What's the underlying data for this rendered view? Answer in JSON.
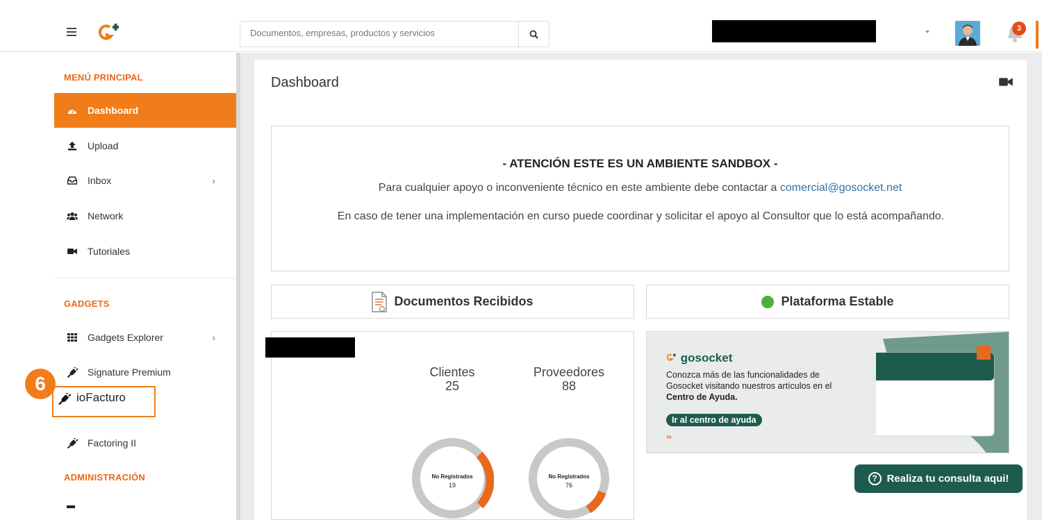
{
  "header": {
    "search_placeholder": "Documentos, empresas, productos y servicios",
    "notification_count": "3"
  },
  "sidebar": {
    "main_title": "MENÚ PRINCIPAL",
    "items": [
      {
        "label": "Dashboard",
        "icon": "tachometer-icon"
      },
      {
        "label": "Upload",
        "icon": "upload-icon"
      },
      {
        "label": "Inbox",
        "icon": "inbox-icon"
      },
      {
        "label": "Network",
        "icon": "users-icon"
      },
      {
        "label": "Tutoriales",
        "icon": "video-camera-icon"
      }
    ],
    "gadgets_title": "GADGETS",
    "gadgets": [
      {
        "label": "Gadgets Explorer",
        "icon": "grid-icon"
      },
      {
        "label": "Signature Premium",
        "icon": "plug-icon"
      },
      {
        "label": "ioFacturo",
        "icon": "plug-icon"
      },
      {
        "label": "Factoring II",
        "icon": "plug-icon"
      }
    ],
    "admin_title": "ADMINISTRACIÓN"
  },
  "callout": {
    "step": "6"
  },
  "main": {
    "title": "Dashboard",
    "notice": {
      "heading": "- ATENCIÓN ESTE ES UN AMBIENTE SANDBOX -",
      "line1": "Para cualquier apoyo o inconveniente técnico en este ambiente debe contactar a",
      "email": "comercial@gosocket.net",
      "line2": "En caso de tener una implementación en curso puede coordinar y solicitar el apoyo al Consultor que lo está acompañando."
    },
    "documents_card": {
      "title": "Documentos Recibidos"
    },
    "platform_card": {
      "title": "Plataforma Estable",
      "status_color": "#4caf3a"
    },
    "stats": {
      "clientes_label": "Clientes",
      "clientes_value": "25",
      "proveedores_label": "Proveedores",
      "proveedores_value": "88",
      "donut1_label": "No Registrados",
      "donut1_value": "19",
      "donut2_label": "No Registrados",
      "donut2_value": "76"
    },
    "promo": {
      "brand": "gosocket",
      "text_pre": "Conozca más de las funcionalidades de Gosocket visitando nuestros artículos en el ",
      "text_bold": "Centro de Ayuda.",
      "cta": "Ir al centro de ayuda",
      "arrows": "›››"
    },
    "chat_button": "Realiza tu consulta aqui!"
  },
  "colors": {
    "accent": "#f07d1a",
    "brand_green": "#1e5b4f",
    "link": "#2f6faa"
  }
}
